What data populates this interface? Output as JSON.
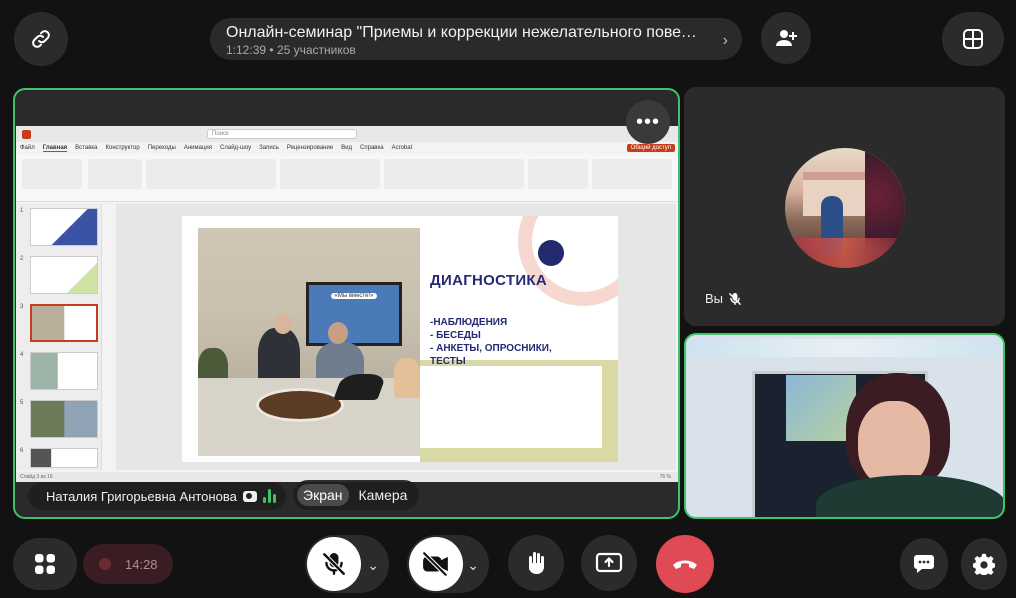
{
  "header": {
    "title": "Онлайн-семинар \"Приемы и коррекции нежелательного поведения\"",
    "duration": "1:12:39",
    "separator": "•",
    "participants": "25 участников"
  },
  "main_tile": {
    "presenter_name": "Наталия Григорьевна Антонова",
    "view_screen_label": "Экран",
    "view_camera_label": "Камера",
    "more_label": "•••"
  },
  "ppt": {
    "search_placeholder": "Поиск",
    "menu": [
      "Файл",
      "Главная",
      "Вставка",
      "Конструктор",
      "Переходы",
      "Анимация",
      "Слайд-шоу",
      "Запись",
      "Рецензирование",
      "Вид",
      "Справка",
      "Acrobat"
    ],
    "share_label": "Общий доступ",
    "thumb_numbers": [
      "1",
      "2",
      "3",
      "4",
      "5",
      "6"
    ],
    "status_left": "Слайд 3 из 16",
    "status_right": "76 %"
  },
  "slide": {
    "title": "ДИАГНОСТИКА",
    "items": [
      "-НАБЛЮДЕНИЯ",
      "- БЕСЕДЫ",
      "- АНКЕТЫ, ОПРОСНИКИ,",
      "ТЕСТЫ"
    ],
    "screen_title": "«Мы вместе!»"
  },
  "self_tile": {
    "label": "Вы"
  },
  "bottom": {
    "recording_time": "14:28"
  },
  "colors": {
    "accent_green": "#3ec36b",
    "hangup_red": "#e04a55",
    "slide_navy": "#252b72"
  }
}
